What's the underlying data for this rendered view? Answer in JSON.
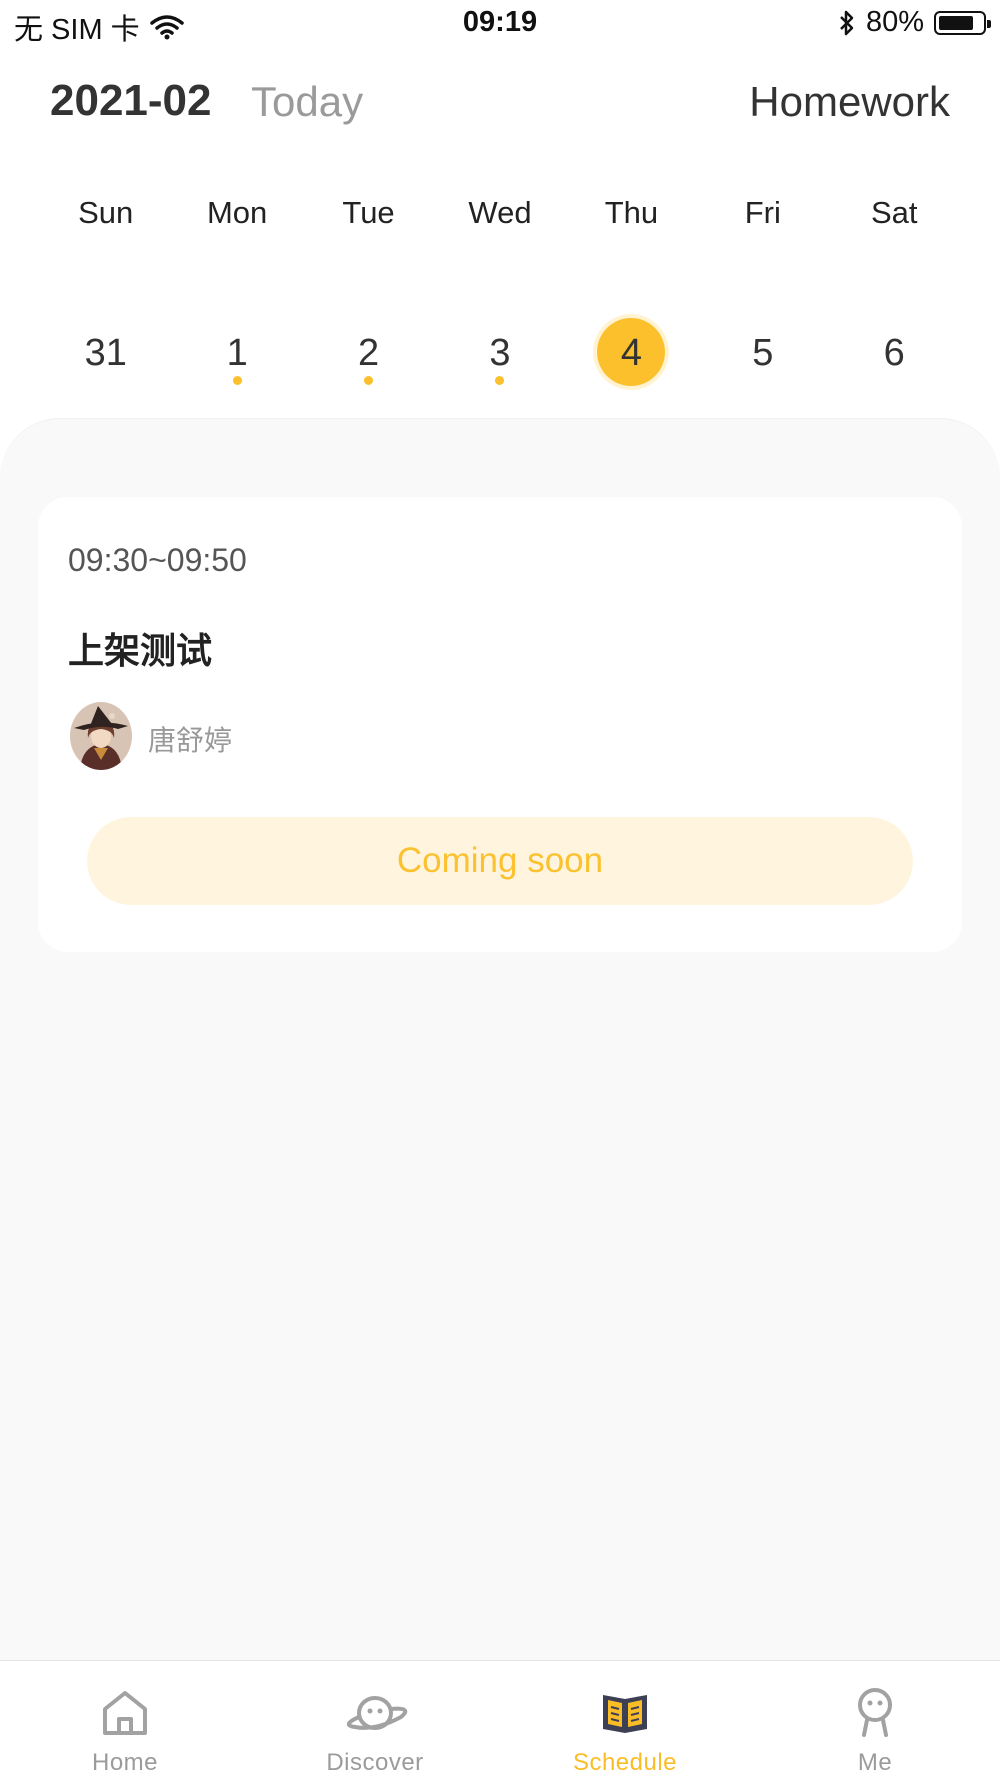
{
  "status_bar": {
    "carrier": "无 SIM 卡",
    "time": "09:19",
    "battery_percent": "80%",
    "battery_level": 0.8
  },
  "header": {
    "month": "2021-02",
    "today_label": "Today",
    "homework_label": "Homework"
  },
  "calendar": {
    "weekdays": [
      "Sun",
      "Mon",
      "Tue",
      "Wed",
      "Thu",
      "Fri",
      "Sat"
    ],
    "dates": [
      {
        "day": "31",
        "has_event": false,
        "selected": false
      },
      {
        "day": "1",
        "has_event": true,
        "selected": false
      },
      {
        "day": "2",
        "has_event": true,
        "selected": false
      },
      {
        "day": "3",
        "has_event": true,
        "selected": false
      },
      {
        "day": "4",
        "has_event": false,
        "selected": true
      },
      {
        "day": "5",
        "has_event": false,
        "selected": false
      },
      {
        "day": "6",
        "has_event": false,
        "selected": false
      }
    ],
    "accent_color": "#fcc02d"
  },
  "lesson": {
    "time": "09:30~09:50",
    "title": "上架测试",
    "teacher": "唐舒婷",
    "button_label": "Coming soon"
  },
  "tabbar": {
    "tabs": [
      {
        "label": "Home",
        "icon": "home-icon",
        "active": false
      },
      {
        "label": "Discover",
        "icon": "planet-icon",
        "active": false
      },
      {
        "label": "Schedule",
        "icon": "book-icon",
        "active": true
      },
      {
        "label": "Me",
        "icon": "person-icon",
        "active": false
      }
    ],
    "active_color": "#fbbd26",
    "inactive_color": "#9b9b9b"
  }
}
